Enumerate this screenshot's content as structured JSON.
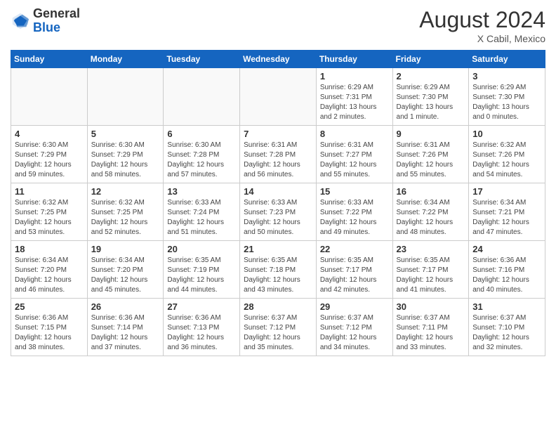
{
  "logo": {
    "general": "General",
    "blue": "Blue"
  },
  "header": {
    "month": "August 2024",
    "location": "X Cabil, Mexico"
  },
  "days_of_week": [
    "Sunday",
    "Monday",
    "Tuesday",
    "Wednesday",
    "Thursday",
    "Friday",
    "Saturday"
  ],
  "weeks": [
    [
      {
        "day": "",
        "info": ""
      },
      {
        "day": "",
        "info": ""
      },
      {
        "day": "",
        "info": ""
      },
      {
        "day": "",
        "info": ""
      },
      {
        "day": "1",
        "info": "Sunrise: 6:29 AM\nSunset: 7:31 PM\nDaylight: 13 hours\nand 2 minutes."
      },
      {
        "day": "2",
        "info": "Sunrise: 6:29 AM\nSunset: 7:30 PM\nDaylight: 13 hours\nand 1 minute."
      },
      {
        "day": "3",
        "info": "Sunrise: 6:29 AM\nSunset: 7:30 PM\nDaylight: 13 hours\nand 0 minutes."
      }
    ],
    [
      {
        "day": "4",
        "info": "Sunrise: 6:30 AM\nSunset: 7:29 PM\nDaylight: 12 hours\nand 59 minutes."
      },
      {
        "day": "5",
        "info": "Sunrise: 6:30 AM\nSunset: 7:29 PM\nDaylight: 12 hours\nand 58 minutes."
      },
      {
        "day": "6",
        "info": "Sunrise: 6:30 AM\nSunset: 7:28 PM\nDaylight: 12 hours\nand 57 minutes."
      },
      {
        "day": "7",
        "info": "Sunrise: 6:31 AM\nSunset: 7:28 PM\nDaylight: 12 hours\nand 56 minutes."
      },
      {
        "day": "8",
        "info": "Sunrise: 6:31 AM\nSunset: 7:27 PM\nDaylight: 12 hours\nand 55 minutes."
      },
      {
        "day": "9",
        "info": "Sunrise: 6:31 AM\nSunset: 7:26 PM\nDaylight: 12 hours\nand 55 minutes."
      },
      {
        "day": "10",
        "info": "Sunrise: 6:32 AM\nSunset: 7:26 PM\nDaylight: 12 hours\nand 54 minutes."
      }
    ],
    [
      {
        "day": "11",
        "info": "Sunrise: 6:32 AM\nSunset: 7:25 PM\nDaylight: 12 hours\nand 53 minutes."
      },
      {
        "day": "12",
        "info": "Sunrise: 6:32 AM\nSunset: 7:25 PM\nDaylight: 12 hours\nand 52 minutes."
      },
      {
        "day": "13",
        "info": "Sunrise: 6:33 AM\nSunset: 7:24 PM\nDaylight: 12 hours\nand 51 minutes."
      },
      {
        "day": "14",
        "info": "Sunrise: 6:33 AM\nSunset: 7:23 PM\nDaylight: 12 hours\nand 50 minutes."
      },
      {
        "day": "15",
        "info": "Sunrise: 6:33 AM\nSunset: 7:22 PM\nDaylight: 12 hours\nand 49 minutes."
      },
      {
        "day": "16",
        "info": "Sunrise: 6:34 AM\nSunset: 7:22 PM\nDaylight: 12 hours\nand 48 minutes."
      },
      {
        "day": "17",
        "info": "Sunrise: 6:34 AM\nSunset: 7:21 PM\nDaylight: 12 hours\nand 47 minutes."
      }
    ],
    [
      {
        "day": "18",
        "info": "Sunrise: 6:34 AM\nSunset: 7:20 PM\nDaylight: 12 hours\nand 46 minutes."
      },
      {
        "day": "19",
        "info": "Sunrise: 6:34 AM\nSunset: 7:20 PM\nDaylight: 12 hours\nand 45 minutes."
      },
      {
        "day": "20",
        "info": "Sunrise: 6:35 AM\nSunset: 7:19 PM\nDaylight: 12 hours\nand 44 minutes."
      },
      {
        "day": "21",
        "info": "Sunrise: 6:35 AM\nSunset: 7:18 PM\nDaylight: 12 hours\nand 43 minutes."
      },
      {
        "day": "22",
        "info": "Sunrise: 6:35 AM\nSunset: 7:17 PM\nDaylight: 12 hours\nand 42 minutes."
      },
      {
        "day": "23",
        "info": "Sunrise: 6:35 AM\nSunset: 7:17 PM\nDaylight: 12 hours\nand 41 minutes."
      },
      {
        "day": "24",
        "info": "Sunrise: 6:36 AM\nSunset: 7:16 PM\nDaylight: 12 hours\nand 40 minutes."
      }
    ],
    [
      {
        "day": "25",
        "info": "Sunrise: 6:36 AM\nSunset: 7:15 PM\nDaylight: 12 hours\nand 38 minutes."
      },
      {
        "day": "26",
        "info": "Sunrise: 6:36 AM\nSunset: 7:14 PM\nDaylight: 12 hours\nand 37 minutes."
      },
      {
        "day": "27",
        "info": "Sunrise: 6:36 AM\nSunset: 7:13 PM\nDaylight: 12 hours\nand 36 minutes."
      },
      {
        "day": "28",
        "info": "Sunrise: 6:37 AM\nSunset: 7:12 PM\nDaylight: 12 hours\nand 35 minutes."
      },
      {
        "day": "29",
        "info": "Sunrise: 6:37 AM\nSunset: 7:12 PM\nDaylight: 12 hours\nand 34 minutes."
      },
      {
        "day": "30",
        "info": "Sunrise: 6:37 AM\nSunset: 7:11 PM\nDaylight: 12 hours\nand 33 minutes."
      },
      {
        "day": "31",
        "info": "Sunrise: 6:37 AM\nSunset: 7:10 PM\nDaylight: 12 hours\nand 32 minutes."
      }
    ]
  ]
}
